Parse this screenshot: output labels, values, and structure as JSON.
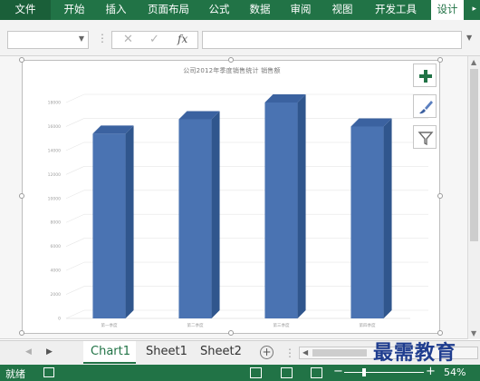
{
  "ribbon": {
    "tabs": [
      "文件",
      "开始",
      "插入",
      "页面布局",
      "公式",
      "数据",
      "审阅",
      "视图",
      "开发工具",
      "设计"
    ],
    "active_index": 9
  },
  "formula_bar": {
    "name_box": "",
    "formula": "",
    "fx_symbol": "fx"
  },
  "chart": {
    "title": "公司2012年季度销售统计 销售额"
  },
  "chart_data": {
    "type": "bar",
    "title": "公司2012年季度销售统计 销售额",
    "categories": [
      "第一季度",
      "第二季度",
      "第三季度",
      "第四季度"
    ],
    "y_ticks": [
      "0",
      "2000",
      "4000",
      "6000",
      "8000",
      "10000",
      "12000",
      "14000",
      "16000",
      "18000"
    ],
    "values": [
      15400,
      16600,
      18000,
      16000
    ],
    "ylim": [
      0,
      18000
    ],
    "style": "3d-column",
    "grid": true,
    "bar_color": "#4a73b2"
  },
  "chart_tools": {
    "elements_icon": "plus-icon",
    "styles_icon": "brush-icon",
    "filter_icon": "filter-icon"
  },
  "sheet_tabs": [
    "Chart1",
    "Sheet1",
    "Sheet2 ..."
  ],
  "active_sheet": "Chart1",
  "status": {
    "ready": "就绪",
    "zoom": "54%"
  },
  "watermark": "最需教育",
  "colors": {
    "accent": "#217346",
    "bar": "#4a73b2",
    "bar_side": "#30568d",
    "bar_top": "#3b62a0"
  }
}
